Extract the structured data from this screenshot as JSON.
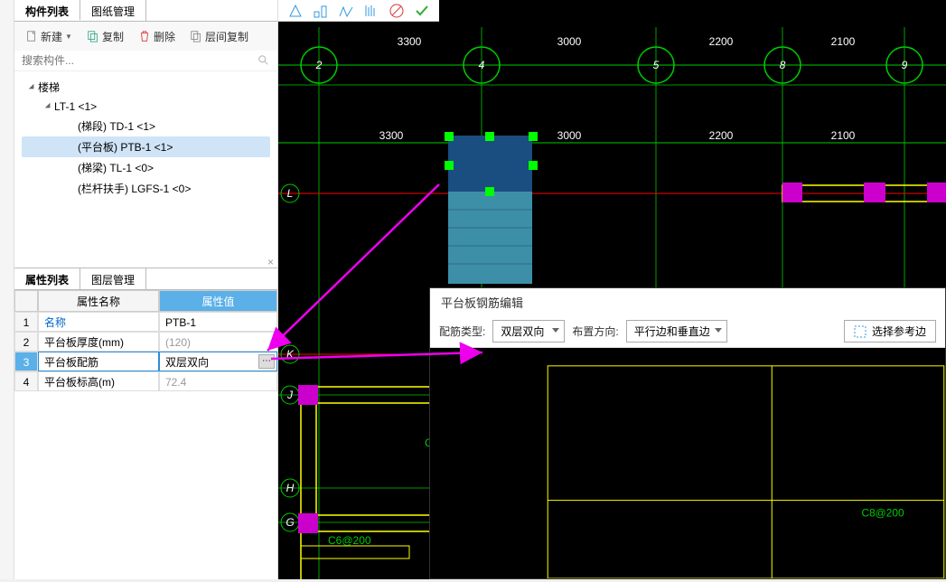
{
  "topTabs": {
    "active": "构件列表",
    "other": "图纸管理"
  },
  "toolbar": {
    "new": "新建",
    "copy": "复制",
    "delete": "删除",
    "layerCopy": "层间复制"
  },
  "search": {
    "placeholder": "搜索构件..."
  },
  "tree": {
    "root": "楼梯",
    "child": "LT-1 <1>",
    "items": [
      "(梯段)  TD-1 <1>",
      "(平台板)  PTB-1 <1>",
      "(梯梁)  TL-1 <0>",
      "(栏杆扶手)  LGFS-1 <0>"
    ],
    "selectedIndex": 1
  },
  "propTabs": {
    "active": "属性列表",
    "other": "图层管理"
  },
  "propHead": {
    "name": "属性名称",
    "value": "属性值"
  },
  "propRows": [
    {
      "n": "1",
      "name": "名称",
      "value": "PTB-1"
    },
    {
      "n": "2",
      "name": "平台板厚度(mm)",
      "value": "(120)"
    },
    {
      "n": "3",
      "name": "平台板配筋",
      "value": "双层双向"
    },
    {
      "n": "4",
      "name": "平台板标高(m)",
      "value": "72.4"
    }
  ],
  "viewport": {
    "topDims": [
      "3300",
      "3000",
      "2200",
      "2100"
    ],
    "innerDims": [
      "3300",
      "3000",
      "2200",
      "2100"
    ],
    "bubbles": [
      "2",
      "4",
      "5",
      "8",
      "9"
    ],
    "leftLabels": [
      "L",
      "K",
      "J",
      "H",
      "G"
    ],
    "bottomText": "C6@200"
  },
  "popup": {
    "title": "平台板钢筋编辑",
    "typeLabel": "配筋类型:",
    "typeValue": "双层双向",
    "dirLabel": "布置方向:",
    "dirValue": "平行边和垂直边",
    "refBtn": "选择参考边",
    "rebar": "C8@200"
  }
}
